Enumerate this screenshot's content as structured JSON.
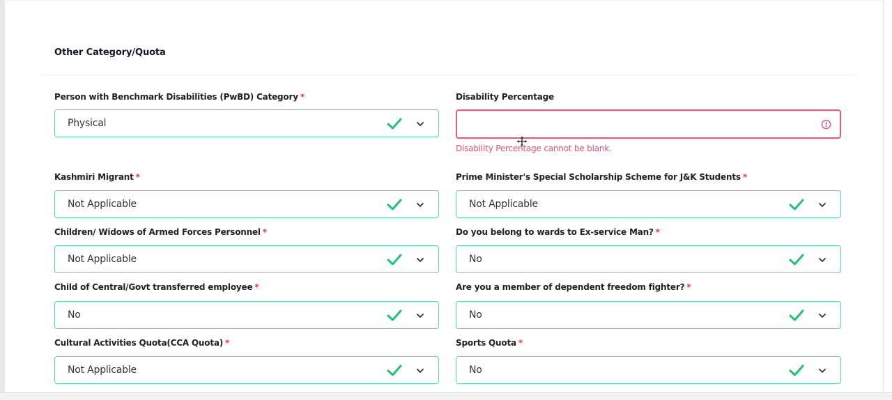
{
  "section": {
    "title": "Other Category/Quota"
  },
  "fields": {
    "pwbd": {
      "label": "Person with Benchmark Disabilities (PwBD) Category",
      "required": "*",
      "value": "Physical"
    },
    "disability_pct": {
      "label": "Disability Percentage",
      "value": "",
      "placeholder": "",
      "error": "Disability Percentage cannot be blank."
    },
    "kashmiri_migrant": {
      "label": "Kashmiri Migrant",
      "required": "*",
      "value": "Not Applicable"
    },
    "pm_scholarship": {
      "label": "Prime Minister's Special Scholarship Scheme for J&K Students",
      "required": "*",
      "value": "Not Applicable"
    },
    "armed_forces": {
      "label": "Children/ Widows of Armed Forces Personnel",
      "required": "*",
      "value": "Not Applicable"
    },
    "ex_service": {
      "label": "Do you belong to wards to Ex-service Man?",
      "required": "*",
      "value": "No"
    },
    "central_govt": {
      "label": "Child of Central/Govt transferred employee",
      "required": "*",
      "value": "No"
    },
    "freedom_fighter": {
      "label": "Are you a member of dependent freedom fighter?",
      "required": "*",
      "value": "No"
    },
    "cca_quota": {
      "label": "Cultural Activities Quota(CCA Quota)",
      "required": "*",
      "value": "Not Applicable"
    },
    "sports_quota": {
      "label": "Sports Quota",
      "required": "*",
      "value": "No"
    }
  },
  "icons": {
    "valid": "check-icon",
    "dropdown": "chevron-down-icon",
    "error": "alert-circle-icon",
    "cursor": "move-cursor-icon"
  },
  "colors": {
    "valid_border": "#5fd3a0",
    "check": "#22c07a",
    "error": "#e65c7a",
    "required": "#e03a3a"
  }
}
